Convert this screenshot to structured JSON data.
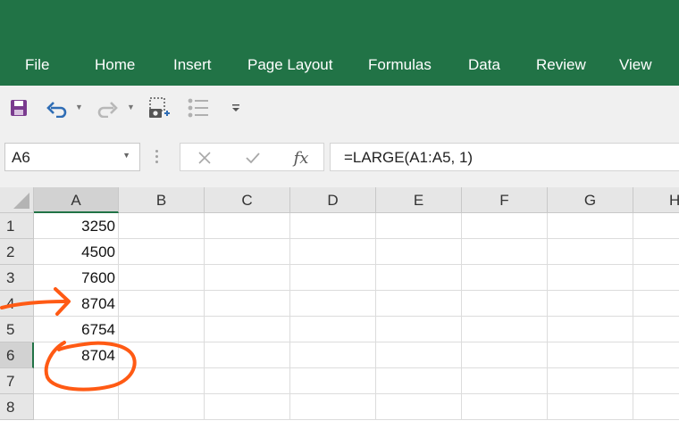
{
  "ribbon": {
    "tabs": [
      "File",
      "Home",
      "Insert",
      "Page Layout",
      "Formulas",
      "Data",
      "Review",
      "View"
    ]
  },
  "quick_access": {
    "icons": [
      "save-icon",
      "undo-icon",
      "redo-icon",
      "screenshot-icon",
      "list-icon",
      "customize-caret-icon"
    ]
  },
  "formula_bar": {
    "name_box": "A6",
    "fx_label": "fx",
    "formula": "=LARGE(A1:A5, 1)"
  },
  "grid": {
    "columns": [
      "A",
      "B",
      "C",
      "D",
      "E",
      "F",
      "G",
      "H"
    ],
    "rows": [
      "1",
      "2",
      "3",
      "4",
      "5",
      "6",
      "7",
      "8"
    ],
    "column_a_values": [
      "3250",
      "4500",
      "7600",
      "8704",
      "6754",
      "8704",
      "",
      ""
    ],
    "active_cell": "A6"
  },
  "annotations": {
    "color": "#ff5a14",
    "items": [
      "arrow pointing to row 4",
      "circle around A6"
    ]
  },
  "colors": {
    "ribbon": "#217346",
    "toolbar": "#f0f0f0",
    "header": "#e6e6e6"
  }
}
